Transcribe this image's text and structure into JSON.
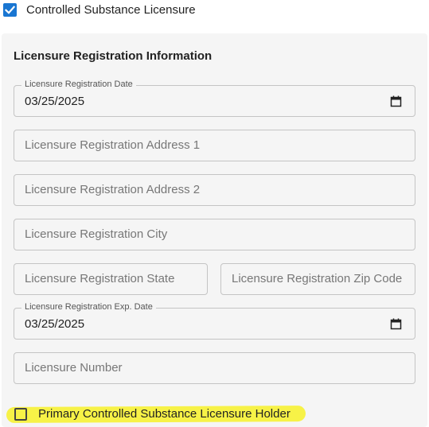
{
  "controlled_substance": {
    "label": "Controlled Substance Licensure",
    "checked": true
  },
  "section": {
    "title": "Licensure Registration Information"
  },
  "fields": {
    "registration_date": {
      "label": "Licensure Registration Date",
      "value": "03/25/2025"
    },
    "address1": {
      "placeholder": "Licensure Registration Address 1"
    },
    "address2": {
      "placeholder": "Licensure Registration Address 2"
    },
    "city": {
      "placeholder": "Licensure Registration City"
    },
    "state": {
      "placeholder": "Licensure Registration State"
    },
    "zip": {
      "placeholder": "Licensure Registration Zip Code"
    },
    "exp_date": {
      "label": "Licensure Registration Exp. Date",
      "value": "03/25/2025"
    },
    "license_number": {
      "placeholder": "Licensure Number"
    }
  },
  "primary_holder": {
    "label": "Primary Controlled Substance Licensure Holder",
    "checked": false,
    "highlight_color": "#f7f247"
  },
  "colors": {
    "accent": "#1976d2",
    "panel_bg": "#f5f5f5",
    "field_border": "#c4c4c4"
  },
  "icons": {
    "checkbox_checked": "checkmark-icon",
    "date_picker": "calendar-icon"
  }
}
